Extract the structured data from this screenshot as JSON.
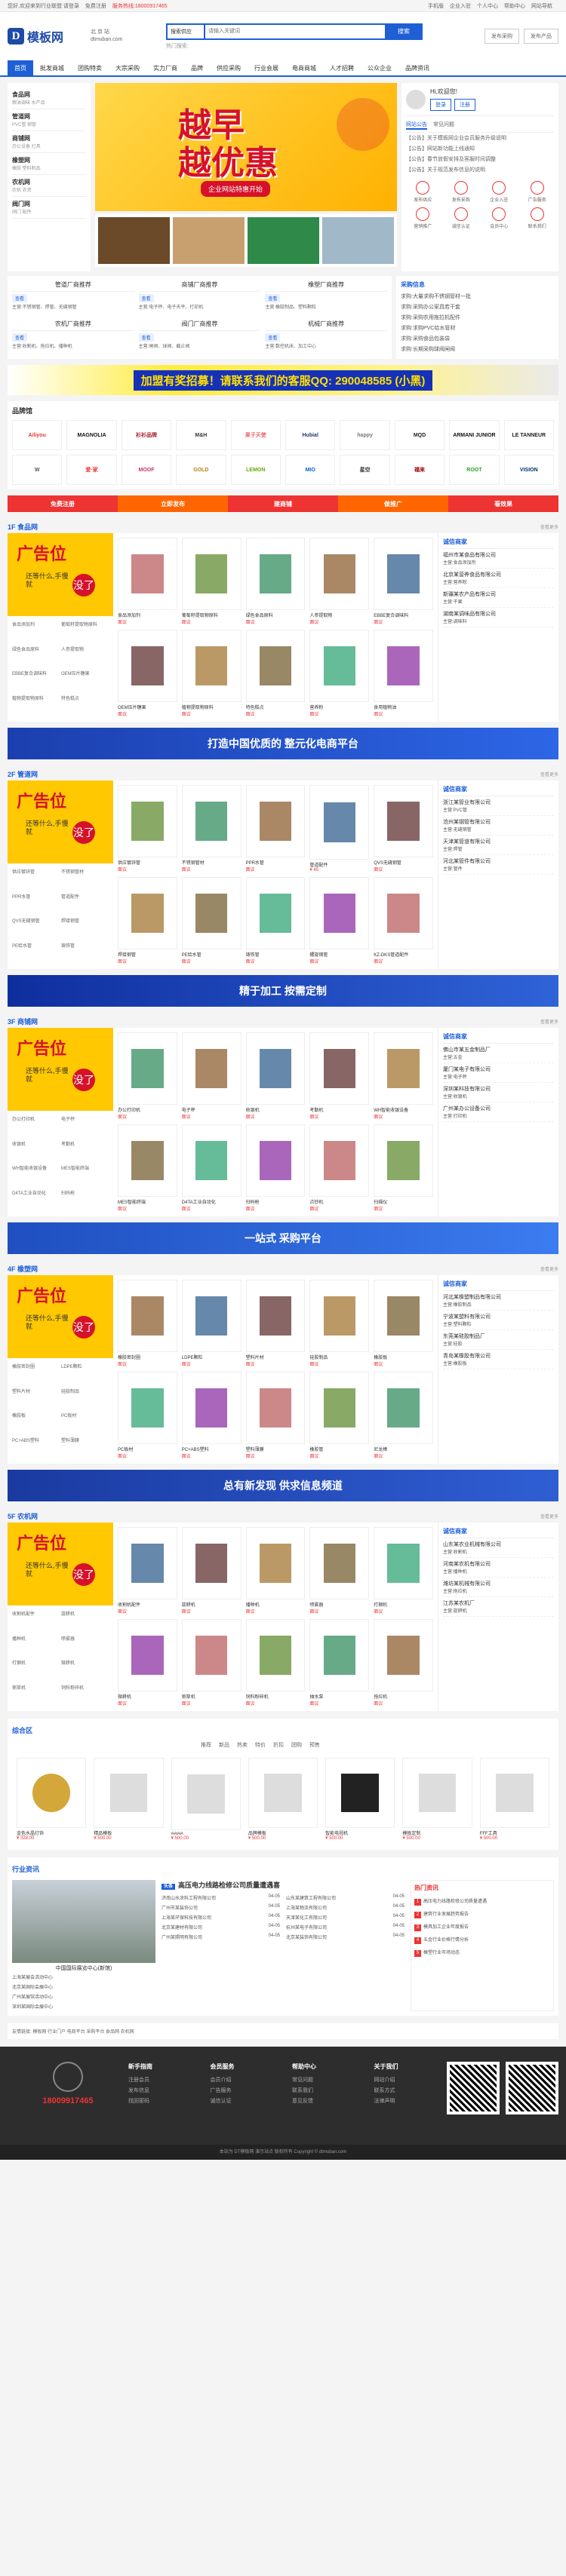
{
  "topbar": {
    "welcome": "您好,欢迎来到行业联盟",
    "login": "请登录",
    "register": "免费注册",
    "hotline": "服务热线:18000917465",
    "links": [
      "手机版",
      "企业入驻",
      "个人中心",
      "帮助中心",
      "网站导航"
    ]
  },
  "header": {
    "logo_mark": "D",
    "logo": "模板网",
    "location": "北 京 站",
    "location_sub": "dtmuban.com",
    "search_type": "搜索供应",
    "search_placeholder": "请输入关键词",
    "search_button": "搜索",
    "hotwords": "热门搜索:",
    "publish_buy": "发布采购",
    "publish_sell": "发布产品"
  },
  "nav": [
    "首页",
    "批发商城",
    "团购特卖",
    "大宗采购",
    "实力厂商",
    "品牌",
    "供应采购",
    "行业会展",
    "电商商城",
    "人才招聘",
    "公众企业",
    "品牌资讯"
  ],
  "categories": [
    {
      "t": "食品网",
      "s": "粮油调味 水产品"
    },
    {
      "t": "管道网",
      "s": "PVC管 钢管"
    },
    {
      "t": "商铺网",
      "s": "办公设备 灯具"
    },
    {
      "t": "橡塑网",
      "s": "橡胶 塑料制品"
    },
    {
      "t": "农机网",
      "s": "农机 农资"
    },
    {
      "t": "阀门网",
      "s": "阀门 配件"
    }
  ],
  "banner": {
    "l1": "越早",
    "l2": "越优惠",
    "cta": "企业网站特惠开始"
  },
  "thumb_captions": [
    "你们百万份一律",
    "优质展会"
  ],
  "user": {
    "greeting": "Hi,欢迎您!",
    "login": "登录",
    "register": "注册"
  },
  "side_tabs": [
    "网站公告",
    "常见问题"
  ],
  "side_news": [
    "【公告】关于模板网企业会员服务升级说明",
    "【公告】网站新功能上线通知",
    "【公告】春节放假安排及客服时间调整",
    "【公告】关于规范发布信息的说明"
  ],
  "quick": [
    "发布供应",
    "发布采购",
    "企业入驻",
    "广告服务",
    "营销推广",
    "诚信认证",
    "会员中心",
    "联系我们"
  ],
  "recs": [
    {
      "t": "管道厂商推荐",
      "b": "查看",
      "p": "主营:不锈钢管、焊管、无缝钢管"
    },
    {
      "t": "商铺厂商推荐",
      "b": "查看",
      "p": "主营:电子秤、电子天平、打印机"
    },
    {
      "t": "橡塑厂商推荐",
      "b": "查看",
      "p": "主营:橡胶制品、塑料颗粒"
    },
    {
      "t": "农机厂商推荐",
      "b": "查看",
      "p": "主营:收割机、拖拉机、播种机"
    },
    {
      "t": "阀门厂商推荐",
      "b": "查看",
      "p": "主营:闸阀、球阀、截止阀"
    },
    {
      "t": "机械厂商推荐",
      "b": "查看",
      "p": "主营:数控机床、加工中心"
    }
  ],
  "demand": {
    "title": "采购信息",
    "items": [
      "求购:大量求购不锈钢管材一批",
      "求购:采购办公家具若干套",
      "求购:采购农用拖拉机配件",
      "求购:求购PVC给水管材",
      "求购:采购食品包装袋",
      "求购:长期采购球阀闸阀"
    ]
  },
  "ad_wide": "加盟有奖招募！请联系我们的客服QQ: 290048585 (小黑)",
  "brand": {
    "title": "品牌馆",
    "items": [
      "Ailiyou",
      "MAGNOLIA",
      "衫衫品牌",
      "M&H",
      "果子天使",
      "Hubial",
      "happy",
      "MQD",
      "ARMANI JUNIOR",
      "LE TANNEUR",
      "W",
      "爱·家",
      "MOOF",
      "GOLD",
      "LEMON",
      "MIO",
      "星空",
      "福来",
      "ROOT",
      "VISION"
    ]
  },
  "strip": [
    "免费注册",
    "立即发布",
    "建商铺",
    "做推广",
    "看效果"
  ],
  "floors": [
    {
      "title": "1F 食品网",
      "more": "查看更多",
      "ad": {
        "a": "广告位",
        "b": "还等什么,手慢就",
        "c": "没了"
      },
      "items": [
        {
          "n": "食品添加剂",
          "p": "面议"
        },
        {
          "n": "葡萄籽提取物原料",
          "p": "面议"
        },
        {
          "n": "绿色食品原料",
          "p": "面议"
        },
        {
          "n": "人参提取物",
          "p": "面议"
        },
        {
          "n": "EBBE复合调味料",
          "p": "面议"
        },
        {
          "n": "OEM压片糖果",
          "p": "面议"
        },
        {
          "n": "植物提取物原料",
          "p": "面议"
        },
        {
          "n": "特色糕点",
          "p": "面议"
        },
        {
          "n": "营养粉",
          "p": "面议"
        },
        {
          "n": "食用植物油",
          "p": "面议"
        }
      ],
      "side_title": "诚信商家",
      "side": [
        {
          "n": "福州市某食品有限公司",
          "s": "主营:食品添加剂"
        },
        {
          "n": "北京某营养食品有限公司",
          "s": "主营:营养粉"
        },
        {
          "n": "新疆某农产品有限公司",
          "s": "主营:干果"
        },
        {
          "n": "湖南某调味品有限公司",
          "s": "主营:调味料"
        }
      ]
    },
    {
      "title": "2F 管道网",
      "more": "查看更多",
      "ad": {
        "a": "广告位",
        "b": "还等什么,手慢就",
        "c": "没了"
      },
      "items": [
        {
          "n": "供应镀锌管",
          "p": "面议"
        },
        {
          "n": "不锈钢管材",
          "p": "面议"
        },
        {
          "n": "PPR水管",
          "p": "面议"
        },
        {
          "n": "管道配件",
          "p": "¥ 45"
        },
        {
          "n": "QVS无缝钢管",
          "p": "面议"
        },
        {
          "n": "焊接钢管",
          "p": "面议"
        },
        {
          "n": "PE给水管",
          "p": "面议"
        },
        {
          "n": "铸铁管",
          "p": "面议"
        },
        {
          "n": "螺旋钢管",
          "p": "面议"
        },
        {
          "n": "KZ-DKS管道配件",
          "p": "面议"
        }
      ],
      "side_title": "诚信商家",
      "side": [
        {
          "n": "浙江某管业有限公司",
          "s": "主营:PVC管"
        },
        {
          "n": "沧州某钢管有限公司",
          "s": "主营:无缝钢管"
        },
        {
          "n": "天津某管道有限公司",
          "s": "主营:焊管"
        },
        {
          "n": "河北某管件有限公司",
          "s": "主营:管件"
        }
      ]
    },
    {
      "title": "3F 商铺网",
      "more": "查看更多",
      "ad": {
        "a": "广告位",
        "b": "还等什么,手慢就",
        "c": "没了"
      },
      "items": [
        {
          "n": "办公打印机",
          "p": "面议"
        },
        {
          "n": "电子秤",
          "p": "面议"
        },
        {
          "n": "收银机",
          "p": "面议"
        },
        {
          "n": "考勤机",
          "p": "面议"
        },
        {
          "n": "WH智能收银设备",
          "p": "面议"
        },
        {
          "n": "MES智能终端",
          "p": "面议"
        },
        {
          "n": "D4TA工业自动化",
          "p": "面议"
        },
        {
          "n": "扫码枪",
          "p": "面议"
        },
        {
          "n": "点钞机",
          "p": "面议"
        },
        {
          "n": "扫描仪",
          "p": "面议"
        }
      ],
      "side_title": "诚信商家",
      "side": [
        {
          "n": "佛山市某五金制品厂",
          "s": "主营:五金"
        },
        {
          "n": "厦门某电子有限公司",
          "s": "主营:电子秤"
        },
        {
          "n": "深圳某科技有限公司",
          "s": "主营:收银机"
        },
        {
          "n": "广州某办公设备公司",
          "s": "主营:打印机"
        }
      ]
    },
    {
      "title": "4F 橡塑网",
      "more": "查看更多",
      "ad": {
        "a": "广告位",
        "b": "还等什么,手慢就",
        "c": "没了"
      },
      "items": [
        {
          "n": "橡胶密封圈",
          "p": "面议"
        },
        {
          "n": "LDPE颗粒",
          "p": "面议"
        },
        {
          "n": "塑料片材",
          "p": "面议"
        },
        {
          "n": "硅胶制品",
          "p": "面议"
        },
        {
          "n": "橡胶板",
          "p": "面议"
        },
        {
          "n": "PC板材",
          "p": "面议"
        },
        {
          "n": "PC+ABS塑料",
          "p": "面议"
        },
        {
          "n": "塑料薄膜",
          "p": "面议"
        },
        {
          "n": "橡胶管",
          "p": "面议"
        },
        {
          "n": "尼龙棒",
          "p": "面议"
        }
      ],
      "side_title": "诚信商家",
      "side": [
        {
          "n": "河北某橡塑制品有限公司",
          "s": "主营:橡胶制品"
        },
        {
          "n": "宁波某塑料有限公司",
          "s": "主营:塑料颗粒"
        },
        {
          "n": "东莞某硅胶制品厂",
          "s": "主营:硅胶"
        },
        {
          "n": "青岛某橡胶有限公司",
          "s": "主营:橡胶板"
        }
      ]
    },
    {
      "title": "5F 农机网",
      "more": "查看更多",
      "ad": {
        "a": "广告位",
        "b": "还等什么,手慢就",
        "c": "没了"
      },
      "items": [
        {
          "n": "收割机配件",
          "p": "面议"
        },
        {
          "n": "旋耕机",
          "p": "面议"
        },
        {
          "n": "播种机",
          "p": "面议"
        },
        {
          "n": "喷雾器",
          "p": "面议"
        },
        {
          "n": "打捆机",
          "p": "面议"
        },
        {
          "n": "微耕机",
          "p": "面议"
        },
        {
          "n": "铡草机",
          "p": "面议"
        },
        {
          "n": "饲料粉碎机",
          "p": "面议"
        },
        {
          "n": "抽水泵",
          "p": "面议"
        },
        {
          "n": "拖拉机",
          "p": "面议"
        }
      ],
      "side_title": "诚信商家",
      "side": [
        {
          "n": "山东某农业机械有限公司",
          "s": "主营:收割机"
        },
        {
          "n": "河南某农机有限公司",
          "s": "主营:播种机"
        },
        {
          "n": "潍坊某机械有限公司",
          "s": "主营:拖拉机"
        },
        {
          "n": "江苏某农机厂",
          "s": "主营:旋耕机"
        }
      ]
    }
  ],
  "floor_banners": [
    "打造中国优质的 整元化电商平台",
    "精于加工 按需定制",
    "一站式 采购平台",
    "总有新发现 供求信息频道"
  ],
  "zonghe": {
    "title": "综合区",
    "tabs": [
      "推荐",
      "新品",
      "热卖",
      "特价",
      "折扣",
      "团购",
      "预售"
    ],
    "items": [
      {
        "n": "金色水晶灯饰",
        "p": "¥ 328.00"
      },
      {
        "n": "精品模板",
        "p": "¥ 500.00"
      },
      {
        "n": "AAAA",
        "p": "¥ 500.00"
      },
      {
        "n": "品牌模板",
        "p": "¥ 500.00"
      },
      {
        "n": "智能电视机",
        "p": "¥ 500.00"
      },
      {
        "n": "模板定制",
        "p": "¥ 500.00"
      },
      {
        "n": "FFF工具",
        "p": "¥ 500.00"
      }
    ]
  },
  "news": {
    "title": "行业资讯",
    "headline": "高压电力线路检修公司质量遭遇喜",
    "img_caption": "中国国际展览中心(新馆)",
    "img_list": [
      "上海某展会活动中心",
      "北京某国际会展中心",
      "广州某展馆活动中心",
      "深圳某国际会展中心"
    ],
    "col1": [
      {
        "t": "济南山水涂料工程有限公司",
        "d": "04-05"
      },
      {
        "t": "广州市某装饰公司",
        "d": "04-05"
      },
      {
        "t": "上海某环保科技有限公司",
        "d": "04-05"
      },
      {
        "t": "北京某建材有限公司",
        "d": "04-05"
      },
      {
        "t": "广州某照明有限公司",
        "d": "04-05"
      }
    ],
    "col2": [
      {
        "t": "山东某建筑工程有限公司",
        "d": "04-05"
      },
      {
        "t": "上海某物流有限公司",
        "d": "04-05"
      },
      {
        "t": "天津某化工有限公司",
        "d": "04-05"
      },
      {
        "t": "杭州某电子有限公司",
        "d": "04-05"
      },
      {
        "t": "北京某装饰有限公司",
        "d": "04-05"
      }
    ],
    "hot_title": "热门资讯",
    "hot": [
      "高压电力线路检修公司质量遭遇",
      "建筑行业发展趋势报告",
      "模具加工企业年度报告",
      "五金行业价格行情分析",
      "橡塑行业市场动态"
    ]
  },
  "links": "友情链接: 模板网  行业门户  电商平台  采购平台  食品网  农机网",
  "footer": {
    "tel": "18009917465",
    "cols": [
      {
        "h": "新手指南",
        "i": [
          "注册会员",
          "发布信息",
          "找回密码"
        ]
      },
      {
        "h": "会员服务",
        "i": [
          "会员介绍",
          "广告服务",
          "诚信认证"
        ]
      },
      {
        "h": "帮助中心",
        "i": [
          "常见问题",
          "联系我们",
          "意见反馈"
        ]
      },
      {
        "h": "关于我们",
        "i": [
          "网站介绍",
          "联系方式",
          "法律声明"
        ]
      }
    ]
  },
  "copyright": "本站为 DT模板网 演示站点 版权所有 Copyright © dtmuban.com"
}
